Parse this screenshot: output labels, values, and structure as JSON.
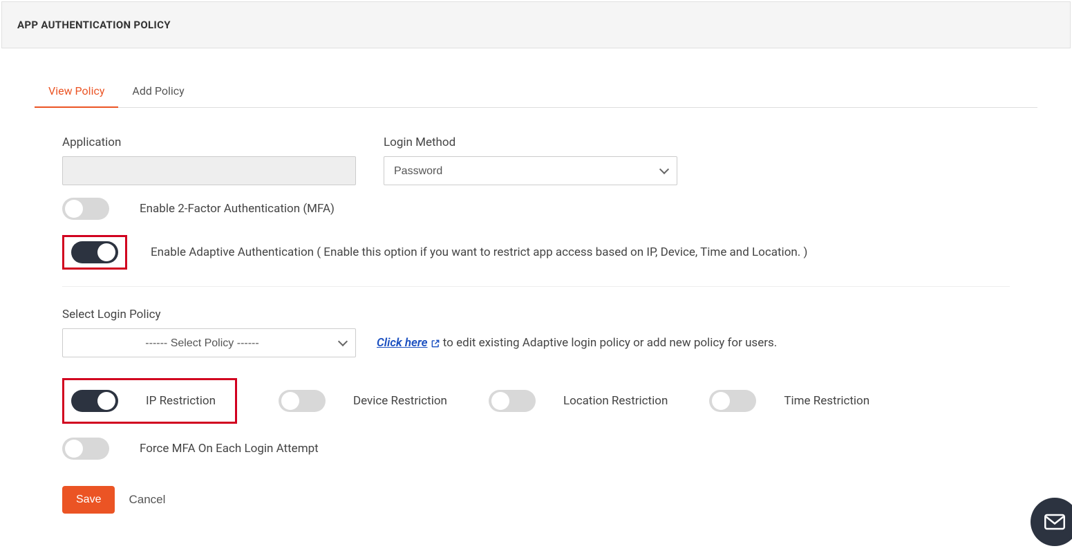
{
  "header": {
    "title": "APP AUTHENTICATION POLICY"
  },
  "tabs": {
    "view": "View Policy",
    "add": "Add Policy"
  },
  "form": {
    "application_label": "Application",
    "application_value": "",
    "login_method_label": "Login Method",
    "login_method_value": "Password",
    "mfa_label": "Enable 2-Factor Authentication (MFA)",
    "adaptive_label": "Enable Adaptive Authentication ( Enable this option if you want to restrict app access based on IP, Device, Time and Location. )",
    "select_policy_label": "Select Login Policy",
    "select_policy_placeholder": "------ Select Policy ------",
    "click_here": "Click here",
    "click_here_rest": " to edit existing Adaptive login policy or add new policy for users.",
    "ip_restriction": "IP Restriction",
    "device_restriction": "Device Restriction",
    "location_restriction": "Location Restriction",
    "time_restriction": "Time Restriction",
    "force_mfa": "Force MFA On Each Login Attempt",
    "save": "Save",
    "cancel": "Cancel"
  }
}
